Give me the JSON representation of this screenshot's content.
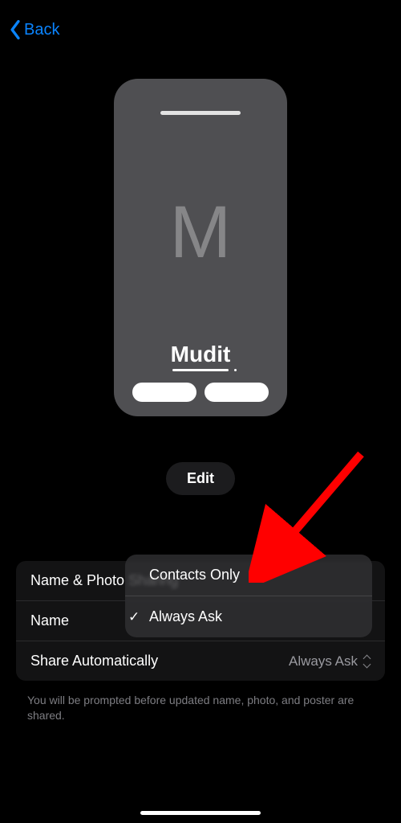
{
  "nav": {
    "back_label": "Back"
  },
  "card": {
    "initial": "M",
    "name": "Mudit"
  },
  "edit": {
    "label": "Edit"
  },
  "settings": {
    "row1_label": "Name & Photo Sharing",
    "row2_label": "Name",
    "row3_label": "Share Automatically",
    "row3_value": "Always Ask"
  },
  "popup": {
    "option1": "Contacts Only",
    "option2": "Always Ask"
  },
  "footer": {
    "text": "You will be prompted before updated name, photo, and poster are shared."
  }
}
